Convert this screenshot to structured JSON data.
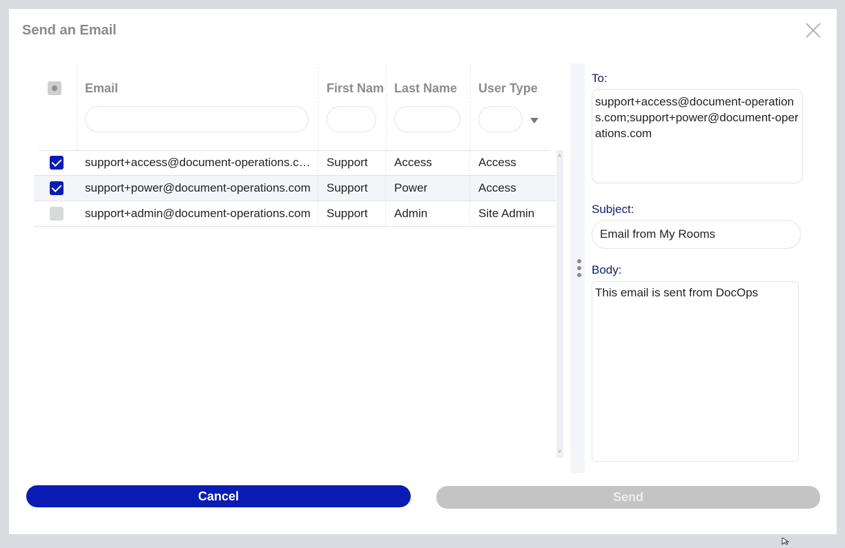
{
  "dialog": {
    "title": "Send an Email",
    "close_icon": "close-icon"
  },
  "grid": {
    "columns": [
      {
        "label": "Email"
      },
      {
        "label": "First Name"
      },
      {
        "label": "Last Name"
      },
      {
        "label": "User Type"
      }
    ],
    "filters": {
      "email": "",
      "first_name": "",
      "last_name": "",
      "user_type": ""
    },
    "rows": [
      {
        "email": "support+access@document-operations.com",
        "first_name": "Support",
        "last_name": "Access",
        "user_type": "Access",
        "checked": true
      },
      {
        "email": "support+power@document-operations.com",
        "first_name": "Support",
        "last_name": "Power",
        "user_type": "Access",
        "checked": true
      },
      {
        "email": "support+admin@document-operations.com",
        "first_name": "Support",
        "last_name": "Admin",
        "user_type": "Site Admin",
        "checked": false
      }
    ]
  },
  "form": {
    "to_label": "To:",
    "to_value": "support+access@document-operations.com;support+power@document-operations.com",
    "subject_label": "Subject:",
    "subject_value": "Email from My Rooms",
    "body_label": "Body:",
    "body_value": "This email is sent from DocOps"
  },
  "actions": {
    "cancel_label": "Cancel",
    "send_label": "Send"
  },
  "colors": {
    "primary": "#0a1cb4",
    "disabled": "#c4c4c4",
    "label_text": "#10206a"
  }
}
